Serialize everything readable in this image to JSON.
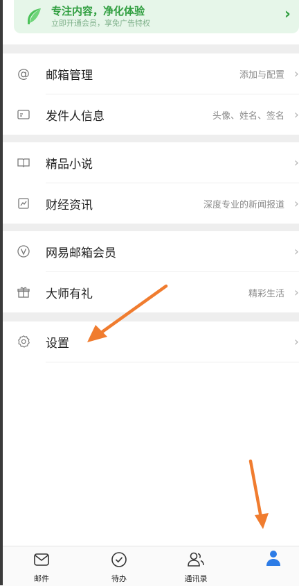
{
  "promo": {
    "title": "专注内容，净化体验",
    "subtitle": "立即开通会员，享免广告特权"
  },
  "menu": {
    "group1": [
      {
        "label": "邮箱管理",
        "hint": "添加与配置",
        "icon": "at-icon"
      },
      {
        "label": "发件人信息",
        "hint": "头像、姓名、签名",
        "icon": "id-card-icon"
      }
    ],
    "group2": [
      {
        "label": "精品小说",
        "hint": "",
        "icon": "book-icon"
      },
      {
        "label": "财经资讯",
        "hint": "深度专业的新闻报道",
        "icon": "chart-icon"
      }
    ],
    "group3": [
      {
        "label": "网易邮箱会员",
        "hint": "",
        "icon": "vip-icon"
      },
      {
        "label": "大师有礼",
        "hint": "精彩生活",
        "icon": "gift-icon"
      }
    ],
    "group4": [
      {
        "label": "设置",
        "hint": "",
        "icon": "gear-icon"
      }
    ]
  },
  "tabbar": {
    "tabs": [
      {
        "label": "邮件",
        "icon": "mail-icon"
      },
      {
        "label": "待办",
        "icon": "check-circle-icon"
      },
      {
        "label": "通讯录",
        "icon": "contacts-icon"
      },
      {
        "label": "",
        "icon": "profile-icon"
      }
    ]
  },
  "colors": {
    "accent_green": "#2f9e3f",
    "profile_blue": "#2d7ce6",
    "annotation_orange": "#f07c2f"
  }
}
